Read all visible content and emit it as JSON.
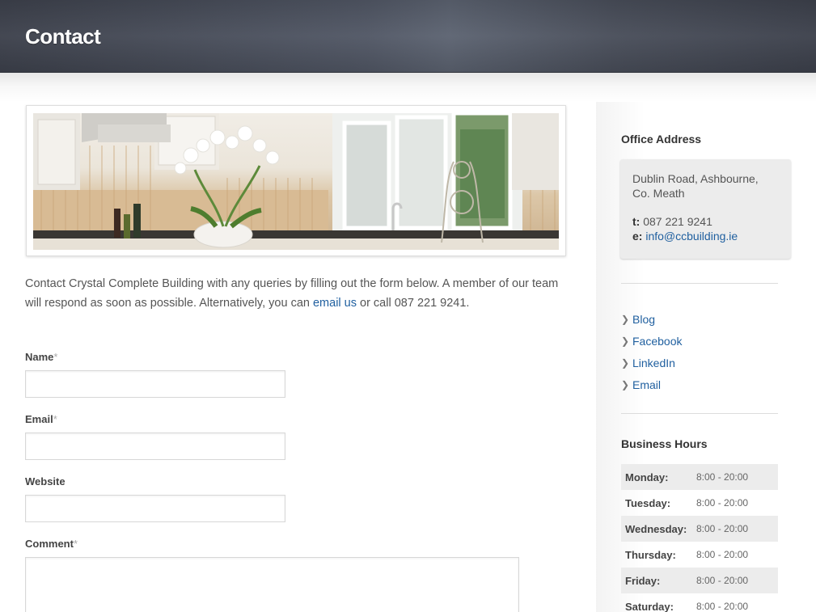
{
  "header": {
    "title": "Contact"
  },
  "banner": {
    "alt": "Kitchen with white orchids and mosaic backsplash"
  },
  "intro": {
    "text_before": "Contact Crystal Complete Building with any queries by filling out the form below. A member of our team will respond as soon as possible. Alternatively, you can ",
    "link_text": "email us",
    "text_after": " or call 087 221 9241."
  },
  "form": {
    "required_mark": "*",
    "name_label": "Name",
    "email_label": "Email",
    "website_label": "Website",
    "comment_label": "Comment",
    "name_value": "",
    "email_value": "",
    "website_value": "",
    "comment_value": ""
  },
  "sidebar": {
    "address_title": "Office Address",
    "address_line1": "Dublin Road, Ashbourne,",
    "address_line2": "Co. Meath",
    "phone_label": "t:",
    "phone": "087 221 9241",
    "email_label": "e:",
    "email": "info@ccbuilding.ie",
    "links": [
      {
        "label": "Blog"
      },
      {
        "label": "Facebook"
      },
      {
        "label": "LinkedIn"
      },
      {
        "label": "Email"
      }
    ],
    "hours_title": "Business Hours",
    "hours": [
      {
        "day": "Monday:",
        "time": "8:00 - 20:00"
      },
      {
        "day": "Tuesday:",
        "time": "8:00 - 20:00"
      },
      {
        "day": "Wednesday:",
        "time": "8:00 - 20:00"
      },
      {
        "day": "Thursday:",
        "time": "8:00 - 20:00"
      },
      {
        "day": "Friday:",
        "time": "8:00 - 20:00"
      },
      {
        "day": "Saturday:",
        "time": "8:00 - 20:00"
      }
    ]
  },
  "colors": {
    "link": "#1f5f9f",
    "header": "#4a4f5b"
  }
}
